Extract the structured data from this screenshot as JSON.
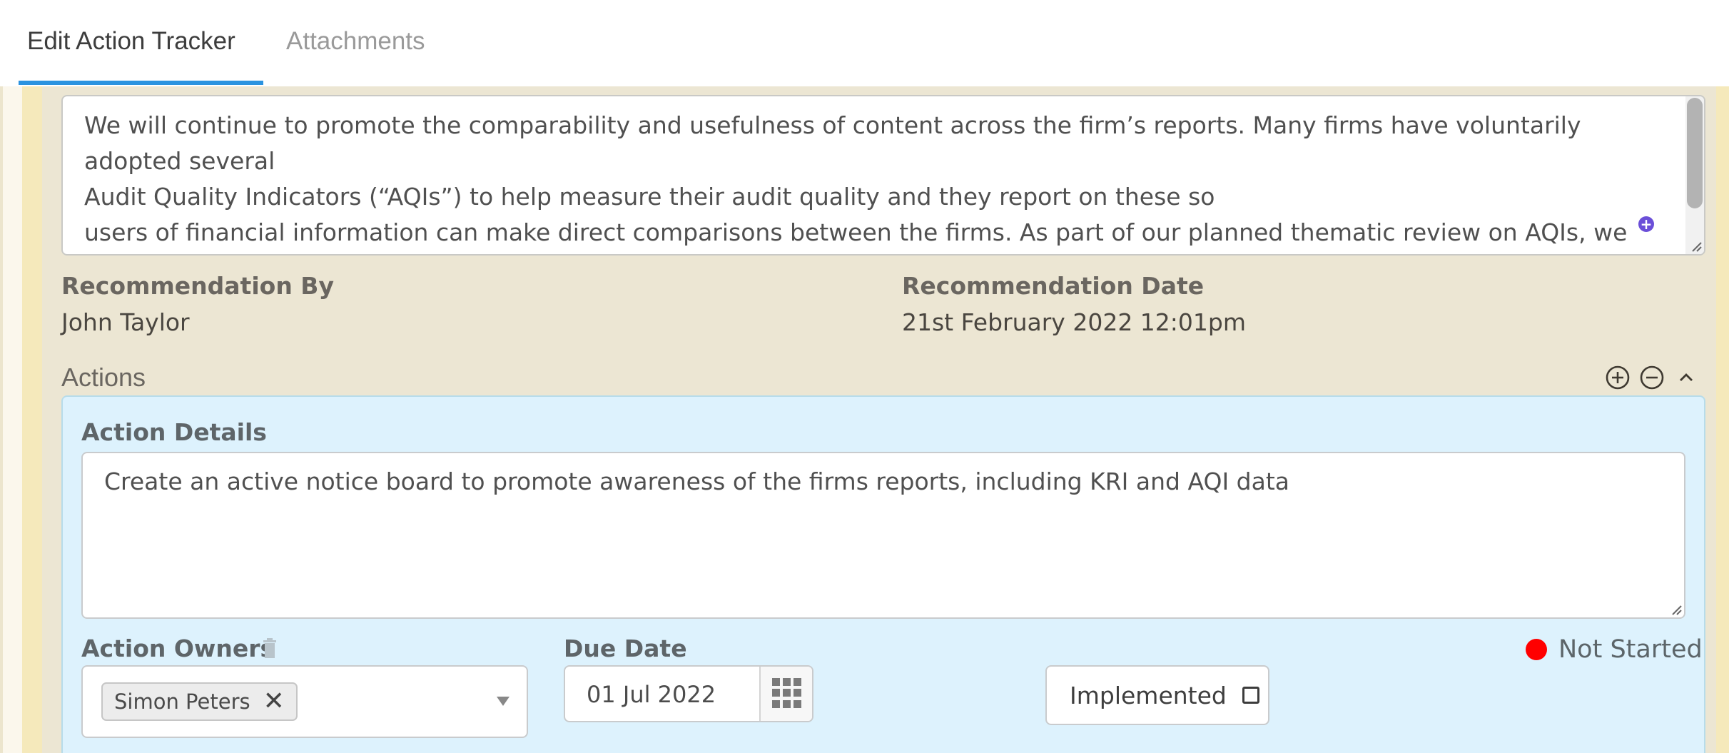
{
  "tabs": [
    {
      "label": "Edit Action Tracker",
      "active": true
    },
    {
      "label": "Attachments",
      "active": false
    }
  ],
  "recommendation": {
    "text": "We will continue to promote the comparability and usefulness of content across the firm’s reports. Many firms have voluntarily adopted several\nAudit Quality Indicators (“AQIs”) to help measure their audit quality and they report on these so\nusers of financial information can make direct comparisons between the firms. As part of our planned thematic review on AQIs, we will consider,\nalong with key stakeholders, whether there are other comparable measures that should be reported within Transparency Reports. We believe",
    "expand_icon": "plus-circle-icon"
  },
  "meta": {
    "recommendation_by_label": "Recommendation By",
    "recommendation_by_value": "John Taylor",
    "recommendation_date_label": "Recommendation Date",
    "recommendation_date_value": "21st February 2022 12:01pm"
  },
  "actions": {
    "title": "Actions",
    "icons": [
      "add-circle-icon",
      "remove-circle-icon",
      "chevron-up-icon"
    ],
    "items": [
      {
        "details_label": "Action Details",
        "details_value": "Create an active notice board to promote awareness of the firms reports, including KRI and AQI data",
        "owners_label": "Action Owners",
        "owners": [
          "Simon Peters"
        ],
        "due_date_label": "Due Date",
        "due_date_value": "01 Jul 2022",
        "implemented_label": "Implemented",
        "implemented_checked": false,
        "status_label": "Not Started",
        "status_color": "#ff0000"
      }
    ]
  },
  "colors": {
    "accent": "#2b93e0",
    "panel_bg": "#ddf2fd",
    "content_bg": "#ece6d3"
  }
}
